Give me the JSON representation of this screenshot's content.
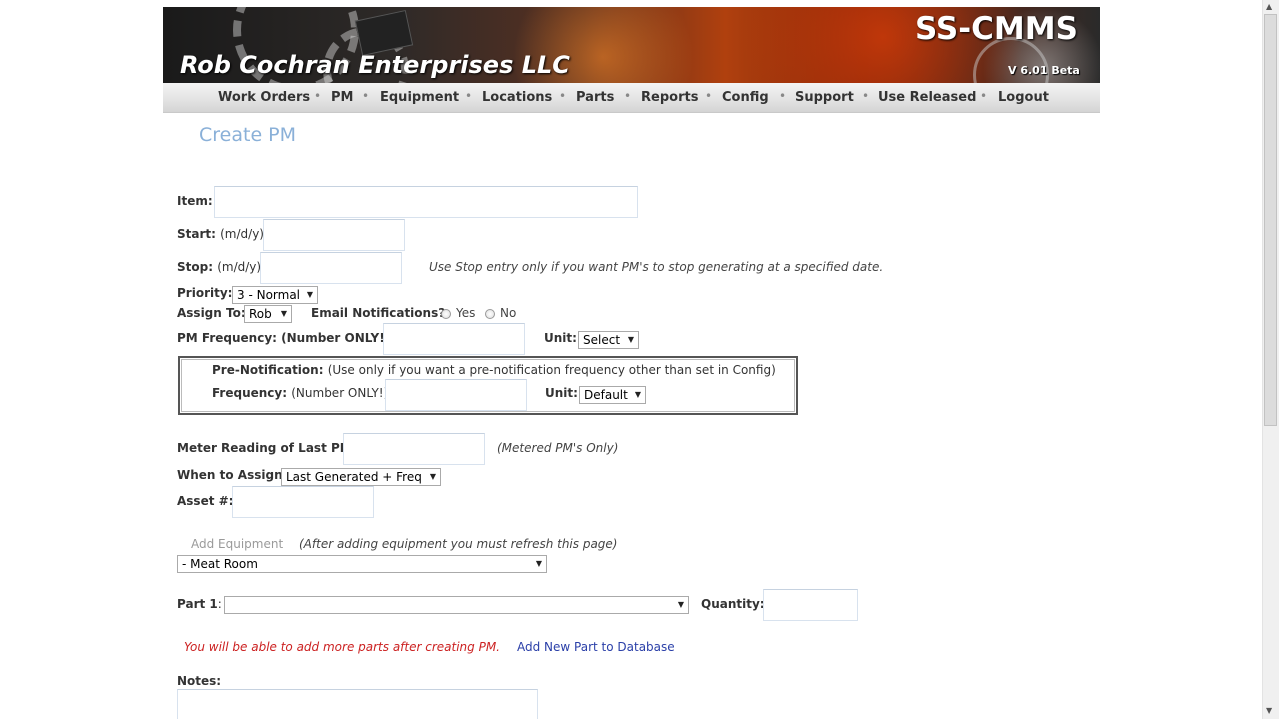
{
  "header": {
    "brand": "Rob Cochran Enterprises LLC",
    "app_title": "SS-CMMS",
    "version": "V 6.01 Beta"
  },
  "nav": {
    "items": [
      "Work Orders",
      "PM",
      "Equipment",
      "Locations",
      "Parts",
      "Reports",
      "Config",
      "Support",
      "Use Released",
      "Logout"
    ]
  },
  "page": {
    "title": "Create PM"
  },
  "form": {
    "item_label": "Item:",
    "start_label": "Start:",
    "start_hint": "(m/d/y)",
    "stop_label": "Stop:",
    "stop_hint": "(m/d/y)",
    "stop_note": "Use Stop entry only if you want PM's to stop generating at a specified date.",
    "priority_label": "Priority:",
    "priority_value": "3 - Normal",
    "assign_label": "Assign To:",
    "assign_value": "Rob",
    "email_label": "Email Notifications?",
    "email_yes": "Yes",
    "email_no": "No",
    "freq_label": "PM Frequency: (Number ONLY!)",
    "unit_label": "Unit:",
    "unit_value": "Select",
    "prenote_label": "Pre-Notification:",
    "prenote_hint": "(Use only if you want a pre-notification frequency other than set in Config)",
    "prefreq_label": "Frequency:",
    "prefreq_hint": "(Number ONLY!)",
    "preunit_label": "Unit:",
    "preunit_value": "Default",
    "meter_label": "Meter Reading of Last PM:",
    "meter_note": "(Metered PM's Only)",
    "when_label": "When to Assign:",
    "when_value": "Last Generated + Freq",
    "asset_label": "Asset #:",
    "add_equipment": "Add Equipment",
    "add_equipment_note": "(After adding equipment you must refresh this page)",
    "equipment_value": "- Meat Room",
    "part_label": "Part 1",
    "part_value": "",
    "quantity_label": "Quantity:",
    "parts_note": "You will be able to add more parts after creating PM.",
    "add_part_link": "Add New Part to Database",
    "notes_label": "Notes:"
  },
  "colors": {
    "heading": "#8ab0d8",
    "warning_text": "#cc2222",
    "link": "#2a3fa8"
  }
}
